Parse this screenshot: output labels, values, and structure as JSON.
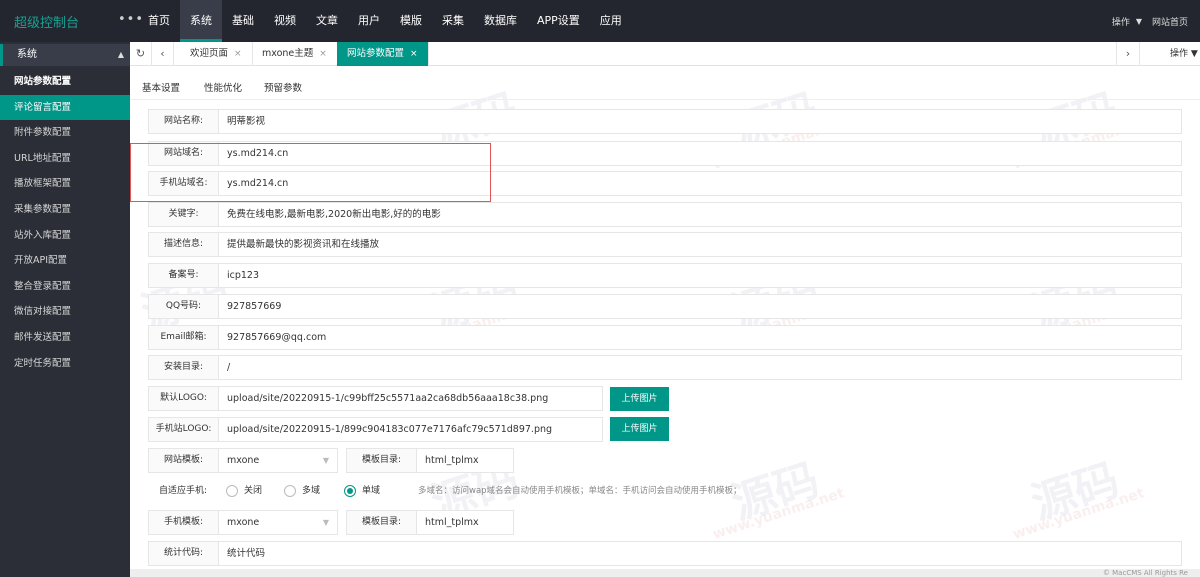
{
  "app": {
    "title": "超级控制台",
    "more": "•••"
  },
  "topnav": [
    "首页",
    "系统",
    "基础",
    "视频",
    "文章",
    "用户",
    "模版",
    "采集",
    "数据库",
    "APP设置",
    "应用"
  ],
  "top_right": {
    "operate": "操作",
    "site_home": "网站首页"
  },
  "sidebar": {
    "section": "系统",
    "items": [
      "网站参数配置",
      "评论留言配置",
      "附件参数配置",
      "URL地址配置",
      "播放框架配置",
      "采集参数配置",
      "站外入库配置",
      "开放API配置",
      "整合登录配置",
      "微信对接配置",
      "邮件发送配置",
      "定时任务配置"
    ]
  },
  "tabs": [
    {
      "label": "欢迎页面",
      "close": "×"
    },
    {
      "label": "mxone主题",
      "close": "×"
    },
    {
      "label": "网站参数配置",
      "close": "×"
    }
  ],
  "tabbar_operate": "操作",
  "subtabs": [
    "基本设置",
    "性能优化",
    "预留参数"
  ],
  "form": {
    "site_name": {
      "label": "网站名称:",
      "value": "明蒂影视"
    },
    "site_domain": {
      "label": "网站域名:",
      "value": "ys.md214.cn"
    },
    "mobile_domain": {
      "label": "手机站域名:",
      "value": "ys.md214.cn"
    },
    "keywords": {
      "label": "关键字:",
      "value": "免费在线电影,最新电影,2020新出电影,好的的电影"
    },
    "description": {
      "label": "描述信息:",
      "value": "提供最新最快的影视资讯和在线播放"
    },
    "icp": {
      "label": "备案号:",
      "value": "icp123"
    },
    "qq": {
      "label": "QQ号码:",
      "value": "927857669"
    },
    "email": {
      "label": "Email邮箱:",
      "value": "927857669@qq.com"
    },
    "install_dir": {
      "label": "安装目录:",
      "value": "/"
    },
    "default_logo": {
      "label": "默认LOGO:",
      "value": "upload/site/20220915-1/c99bff25c5571aa2ca68db56aaa18c38.png",
      "button": "上传图片"
    },
    "mobile_logo": {
      "label": "手机站LOGO:",
      "value": "upload/site/20220915-1/899c904183c077e7176afc79c571d897.png",
      "button": "上传图片"
    },
    "site_template": {
      "label": "网站模板:",
      "value": "mxone",
      "dir_label": "模板目录:",
      "dir_value": "html_tplmx"
    },
    "adaptive": {
      "label": "自适应手机:",
      "options": [
        "关闭",
        "多域",
        "单域"
      ],
      "selected": "单域",
      "tip": "多域名：访问wap域名会自动使用手机模板；单域名：手机访问会自动使用手机模板；"
    },
    "mobile_template": {
      "label": "手机模板:",
      "value": "mxone",
      "dir_label": "模板目录:",
      "dir_value": "html_tplmx"
    },
    "stats": {
      "label": "统计代码:",
      "value": "统计代码"
    }
  },
  "footer": "© MacCMS All Rights Re",
  "watermark": {
    "text": "源码",
    "sub": "www.yuanma.net"
  }
}
